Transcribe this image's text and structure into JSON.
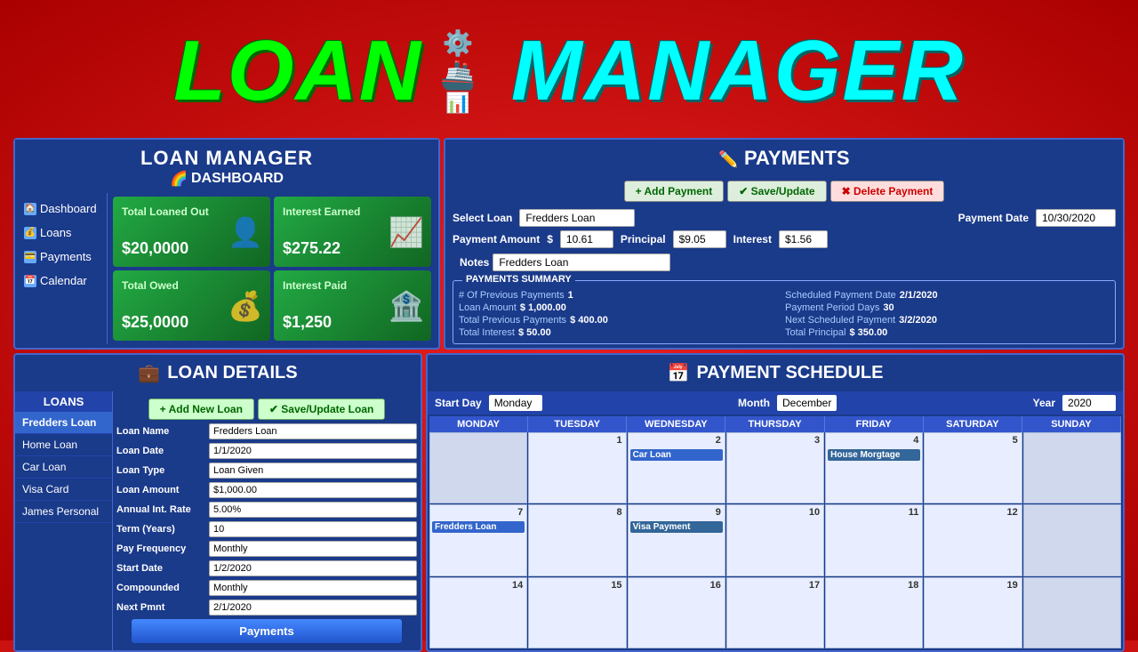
{
  "header": {
    "title_loan": "LOAN",
    "title_manager": "MANAGER"
  },
  "dashboard": {
    "title": "LOAN MANAGER",
    "subtitle": "DASHBOARD",
    "sidebar": {
      "items": [
        {
          "label": "Dashboard",
          "icon": "🏠"
        },
        {
          "label": "Loans",
          "icon": "💰"
        },
        {
          "label": "Payments",
          "icon": "💳"
        },
        {
          "label": "Calendar",
          "icon": "📅"
        }
      ]
    },
    "cards": [
      {
        "label": "Total Loaned Out",
        "value": "$20,0000",
        "icon": "👤"
      },
      {
        "label": "Interest Earned",
        "value": "$275.22",
        "icon": "📈"
      },
      {
        "label": "Total Owed",
        "value": "$25,0000",
        "icon": "💰"
      },
      {
        "label": "Interest Paid",
        "value": "$1,250",
        "icon": "🏦"
      }
    ]
  },
  "payments": {
    "title": "PAYMENTS",
    "buttons": {
      "add": "+ Add Payment",
      "save": "✔ Save/Update",
      "delete": "✖ Delete Payment"
    },
    "select_loan_label": "Select Loan",
    "select_loan_value": "Fredders Loan",
    "payment_date_label": "Payment Date",
    "payment_date_value": "10/30/2020",
    "payment_amount_label": "Payment Amount",
    "currency": "$",
    "payment_amount_value": "10.61",
    "principal_label": "Principal",
    "principal_value": "$9.05",
    "interest_label": "Interest",
    "interest_value": "$1.56",
    "notes_label": "Notes",
    "notes_value": "Fredders Loan",
    "summary": {
      "title": "PAYMENTS SUMMARY",
      "prev_payments_label": "# Of Previous Payments",
      "prev_payments_value": "1",
      "scheduled_date_label": "Scheduled Payment Date",
      "scheduled_date_value": "2/1/2020",
      "loan_amount_label": "Loan Amount",
      "loan_amount_value": "$ 1,000.00",
      "period_days_label": "Payment Period Days",
      "period_days_value": "30",
      "total_prev_label": "Total Previous Payments",
      "total_prev_value": "$ 400.00",
      "next_scheduled_label": "Next Scheduled Payment",
      "next_scheduled_value": "3/2/2020",
      "total_interest_label": "Total Interest",
      "total_interest_value": "$ 50.00",
      "total_principal_label": "Total Principal",
      "total_principal_value": "$ 350.00"
    }
  },
  "loan_details": {
    "title": "LOAN DETAILS",
    "buttons": {
      "add": "+ Add New Loan",
      "save": "✔ Save/Update Loan"
    },
    "loans_list": {
      "title": "LOANS",
      "items": [
        {
          "label": "Fredders Loan",
          "active": true
        },
        {
          "label": "Home Loan",
          "active": false
        },
        {
          "label": "Car Loan",
          "active": false
        },
        {
          "label": "Visa Card",
          "active": false
        },
        {
          "label": "James Personal",
          "active": false
        }
      ]
    },
    "fields": [
      {
        "label": "Loan Name",
        "value": "Fredders Loan"
      },
      {
        "label": "Loan Date",
        "value": "1/1/2020"
      },
      {
        "label": "Loan Type",
        "value": "Loan Given"
      },
      {
        "label": "Loan Amount",
        "value": "$1,000.00"
      },
      {
        "label": "Annual Int. Rate",
        "value": "5.00%"
      },
      {
        "label": "Term (Years)",
        "value": "10"
      },
      {
        "label": "Pay Frequency",
        "value": "Monthly"
      },
      {
        "label": "Start Date",
        "value": "1/2/2020"
      },
      {
        "label": "Compounded",
        "value": "Monthly"
      },
      {
        "label": "Next Pmnt",
        "value": "2/1/2020"
      }
    ],
    "payments_button": "Payments"
  },
  "payment_schedule": {
    "title": "PAYMENT SCHEDULE",
    "controls": {
      "start_day_label": "Start Day",
      "start_day_value": "Monday",
      "month_label": "Month",
      "month_value": "December",
      "year_label": "Year",
      "year_value": "2020"
    },
    "days": [
      "MONDAY",
      "TUESDAY",
      "WEDNESDAY",
      "THURSDAY",
      "FRIDAY",
      "SATURDAY",
      "SUNDAY"
    ],
    "weeks": [
      {
        "cells": [
          {
            "num": "",
            "empty": true
          },
          {
            "num": "1",
            "events": []
          },
          {
            "num": "2",
            "events": [
              {
                "label": "Car Loan",
                "color": "blue"
              }
            ]
          },
          {
            "num": "3",
            "events": []
          },
          {
            "num": "4",
            "events": [
              {
                "label": "House Morgtage",
                "color": "teal"
              }
            ]
          },
          {
            "num": "5",
            "events": []
          },
          {
            "num": "",
            "empty": true
          }
        ]
      },
      {
        "cells": [
          {
            "num": "7",
            "events": []
          },
          {
            "num": "8",
            "events": []
          },
          {
            "num": "9",
            "events": []
          },
          {
            "num": "10",
            "events": []
          },
          {
            "num": "11",
            "events": []
          },
          {
            "num": "12",
            "events": []
          },
          {
            "num": "",
            "empty": true
          }
        ]
      },
      {
        "cells": [
          {
            "num": "",
            "events": [
              {
                "label": "Fredders Loan",
                "color": "blue"
              }
            ]
          },
          {
            "num": "",
            "events": []
          },
          {
            "num": "",
            "events": [
              {
                "label": "Visa Payment",
                "color": "teal"
              }
            ]
          },
          {
            "num": "",
            "events": []
          },
          {
            "num": "",
            "events": []
          },
          {
            "num": "",
            "events": []
          },
          {
            "num": "",
            "empty": true
          }
        ]
      },
      {
        "cells": [
          {
            "num": "14",
            "events": []
          },
          {
            "num": "15",
            "events": []
          },
          {
            "num": "16",
            "events": []
          },
          {
            "num": "17",
            "events": []
          },
          {
            "num": "",
            "events": []
          },
          {
            "num": "19",
            "events": []
          },
          {
            "num": "",
            "empty": true
          }
        ]
      }
    ]
  }
}
